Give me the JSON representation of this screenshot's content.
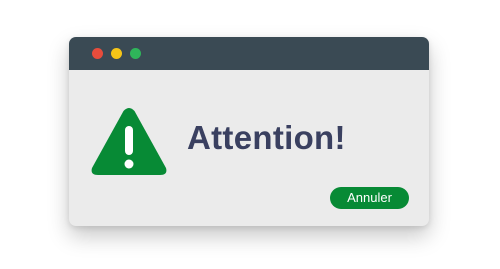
{
  "window": {
    "controls": [
      {
        "name": "close-dot",
        "color": "#e74c3c"
      },
      {
        "name": "minimize-dot",
        "color": "#f5c518"
      },
      {
        "name": "maximize-dot",
        "color": "#2fb55a"
      }
    ]
  },
  "alert": {
    "icon": "warning-icon",
    "icon_color": "#078a35",
    "title": "Attention!",
    "cancel_label": "Annuler",
    "button_color": "#078a35"
  }
}
